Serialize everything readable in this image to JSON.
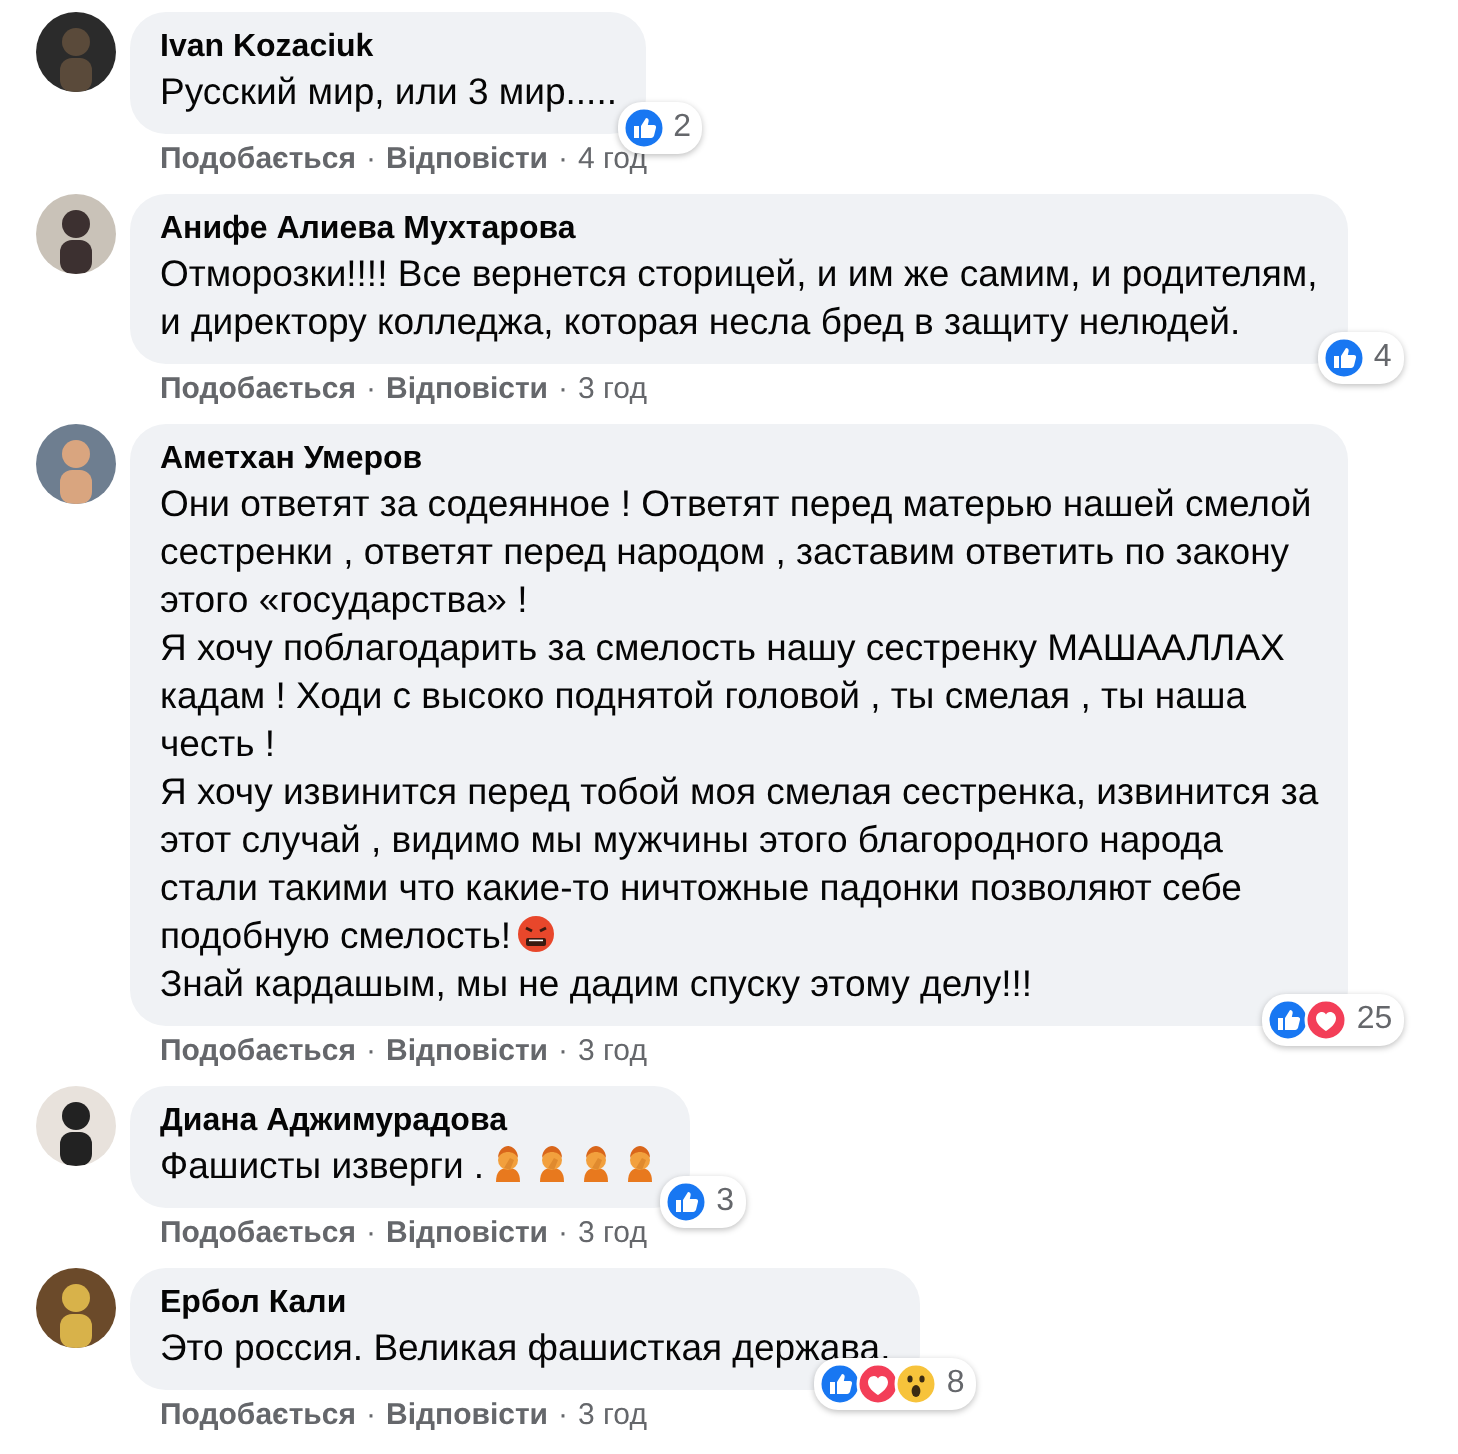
{
  "comments": [
    {
      "author": "Ivan Kozaciuk",
      "text": "Русский мир, или 3 мир.....",
      "reactions": [
        {
          "kind": "like"
        }
      ],
      "reaction_count": "2",
      "meta": [
        {
          "kind": "action",
          "text": "Подобається"
        },
        {
          "kind": "separator",
          "text": "·"
        },
        {
          "kind": "action",
          "text": "Відповісти"
        },
        {
          "kind": "separator",
          "text": "·"
        },
        {
          "kind": "time",
          "text": "4 год"
        }
      ]
    },
    {
      "author": "Анифе Алиева Мухтарова",
      "text": "Отморозки!!!! Все вернется сторицей, и им же самим, и родителям,\nи директору колледжа, которая несла бред в защиту нелюдей.",
      "reactions": [
        {
          "kind": "like"
        }
      ],
      "reaction_count": "4",
      "meta": [
        {
          "kind": "action",
          "text": "Подобається"
        },
        {
          "kind": "separator",
          "text": "·"
        },
        {
          "kind": "action",
          "text": "Відповісти"
        },
        {
          "kind": "separator",
          "text": "·"
        },
        {
          "kind": "time",
          "text": "3 год"
        }
      ]
    },
    {
      "author": "Аметхан Умеров",
      "text": "Они ответят за содеянное ! Ответят перед матерью нашей смелой\nсестренки , ответят перед народом , заставим ответить по закону\nэтого «государства» !\nЯ хочу поблагодарить за смелость нашу сестренку МАШААЛЛАХ\nкадам ! Ходи с высоко поднятой головой , ты смелая , ты наша\nчесть !\nЯ хочу извинится перед тобой моя смелая сестренка, извинится за\nэтот случай , видимо мы мужчины этого благородного народа\nстали такими что какие-то ничтожные падонки позволяют себе\nподобную смелость!",
      "emojis": [
        {
          "kind": "angry"
        }
      ],
      "text_after": "Знай кардашым, мы не дадим спуску этому делу!!!",
      "reactions": [
        {
          "kind": "like"
        },
        {
          "kind": "love"
        }
      ],
      "reaction_count": "25",
      "meta": [
        {
          "kind": "action",
          "text": "Подобається"
        },
        {
          "kind": "separator",
          "text": "·"
        },
        {
          "kind": "action",
          "text": "Відповісти"
        },
        {
          "kind": "separator",
          "text": "·"
        },
        {
          "kind": "time",
          "text": "3 год"
        }
      ]
    },
    {
      "author": "Диана Аджимурадова",
      "text": "Фашисты изверги .",
      "emojis": [
        {
          "kind": "facepalm"
        },
        {
          "kind": "facepalm"
        },
        {
          "kind": "facepalm"
        },
        {
          "kind": "facepalm"
        }
      ],
      "reactions": [
        {
          "kind": "like"
        }
      ],
      "reaction_count": "3",
      "meta": [
        {
          "kind": "action",
          "text": "Подобається"
        },
        {
          "kind": "separator",
          "text": "·"
        },
        {
          "kind": "action",
          "text": "Відповісти"
        },
        {
          "kind": "separator",
          "text": "·"
        },
        {
          "kind": "time",
          "text": "3 год"
        }
      ]
    },
    {
      "author": "Ербол Кали",
      "text": "Это россия. Великая фашисткая держава.",
      "reactions": [
        {
          "kind": "like"
        },
        {
          "kind": "love"
        },
        {
          "kind": "wow"
        }
      ],
      "reaction_count": "8",
      "meta": [
        {
          "kind": "action",
          "text": "Подобається"
        },
        {
          "kind": "separator",
          "text": "·"
        },
        {
          "kind": "action",
          "text": "Відповісти"
        },
        {
          "kind": "separator",
          "text": "·"
        },
        {
          "kind": "time",
          "text": "3 год"
        }
      ]
    }
  ]
}
